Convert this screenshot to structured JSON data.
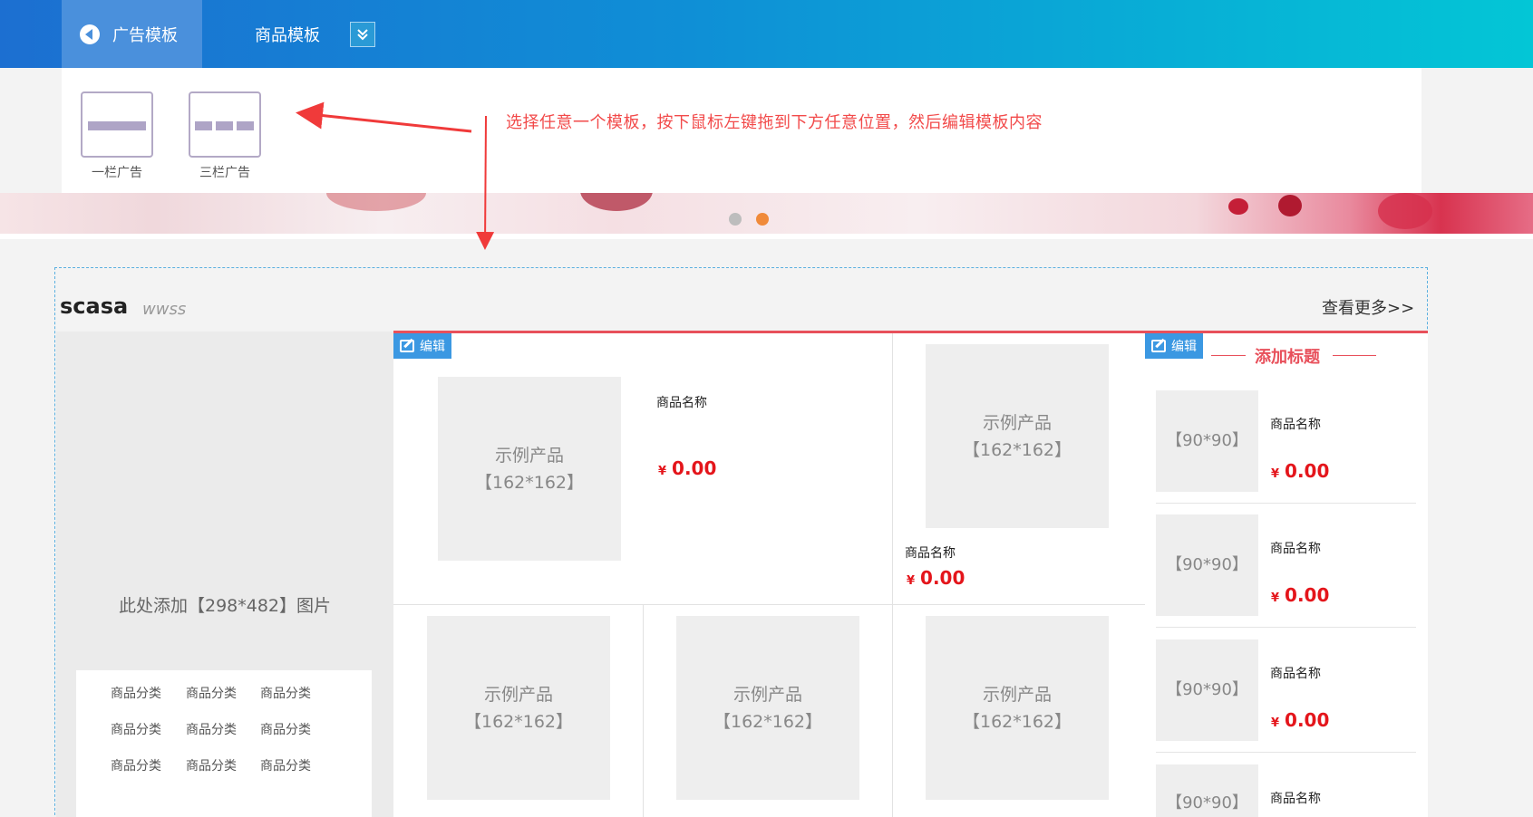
{
  "topbar": {
    "tabs": [
      {
        "label": "广告模板",
        "icon": "speaker-icon",
        "active": true
      },
      {
        "label": "商品模板",
        "icon": "grid-icon",
        "active": false
      }
    ],
    "dropdown_icon": "chevron-double-down-icon"
  },
  "templates": [
    {
      "label": "一栏广告"
    },
    {
      "label": "三栏广告"
    }
  ],
  "hint": "选择任意一个模板，按下鼠标左键拖到下方任意位置，然后编辑模板内容",
  "colors": {
    "accent": "#3b98e2",
    "price": "#e4151b",
    "hint": "#f24a4a",
    "title_line": "#e8505b"
  },
  "banner": {
    "dots": [
      {
        "active": false
      },
      {
        "active": true
      }
    ]
  },
  "module": {
    "title": "scasa",
    "subtitle": "wwss",
    "more": "查看更多>>",
    "left_image_text": "此处添加【298*482】图片",
    "categories": [
      "商品分类",
      "商品分类",
      "商品分类",
      "商品分类",
      "商品分类",
      "商品分类",
      "商品分类",
      "商品分类",
      "商品分类"
    ],
    "edit_label": "编辑",
    "featured": {
      "placeholder_line1": "示例产品",
      "placeholder_line2": "【162*162】",
      "name": "商品名称",
      "currency": "¥",
      "price": "0.00"
    },
    "top_right": {
      "placeholder_line1": "示例产品",
      "placeholder_line2": "【162*162】",
      "name": "商品名称",
      "currency": "¥",
      "price": "0.00"
    },
    "bottom_products": [
      {
        "placeholder_line1": "示例产品",
        "placeholder_line2": "【162*162】"
      },
      {
        "placeholder_line1": "示例产品",
        "placeholder_line2": "【162*162】"
      },
      {
        "placeholder_line1": "示例产品",
        "placeholder_line2": "【162*162】"
      }
    ],
    "side": {
      "title": "添加标题",
      "items": [
        {
          "placeholder": "【90*90】",
          "name": "商品名称",
          "currency": "¥",
          "price": "0.00"
        },
        {
          "placeholder": "【90*90】",
          "name": "商品名称",
          "currency": "¥",
          "price": "0.00"
        },
        {
          "placeholder": "【90*90】",
          "name": "商品名称",
          "currency": "¥",
          "price": "0.00"
        },
        {
          "placeholder": "【90*90】",
          "name": "商品名称"
        }
      ]
    }
  }
}
